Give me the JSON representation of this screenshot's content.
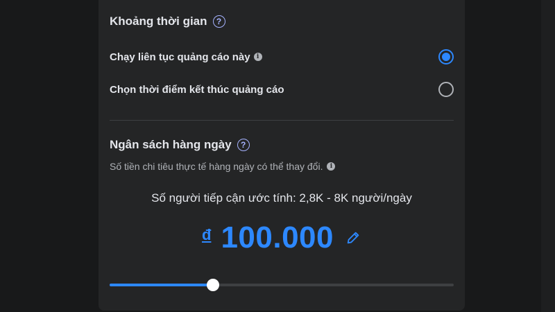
{
  "duration": {
    "title": "Khoảng thời gian",
    "options": [
      {
        "label": "Chạy liên tục quảng cáo này",
        "selected": true,
        "has_info": true
      },
      {
        "label": "Chọn thời điểm kết thúc quảng cáo",
        "selected": false,
        "has_info": false
      }
    ]
  },
  "budget": {
    "title": "Ngân sách hàng ngày",
    "subtext": "Số tiền chi tiêu thực tế hàng ngày có thể thay đổi.",
    "reach": "Số người tiếp cận ước tính: 2,8K - 8K người/ngày",
    "currency": "đ",
    "amount": "100.000",
    "slider_fraction": 0.3
  },
  "icons": {
    "help": "question-circle-icon",
    "info": "info-circle-icon",
    "edit": "pencil-icon"
  },
  "colors": {
    "accent": "#2d88ff",
    "panel": "#242526",
    "background": "#18191a"
  }
}
